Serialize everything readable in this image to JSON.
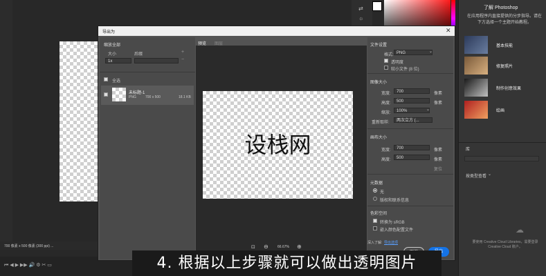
{
  "background_canvas": {},
  "status_bar": {
    "text": "700 像素 x 500 像素 (300 ppi) ..."
  },
  "dialog": {
    "title": "导出为",
    "left_panel": {
      "scale_all_label": "缩放全部",
      "size_header": "大小",
      "suffix_header": "后缀",
      "scale_value": "1x",
      "select_all_label": "全选",
      "item": {
        "name": "未标题-1",
        "format": "PNG",
        "dimensions": "700 x 500",
        "size": "18.1 KB"
      }
    },
    "preview_tabs": [
      "预览",
      "图层"
    ],
    "preview_text": "设栈网",
    "zoom": "66.67%",
    "settings": {
      "file_settings_header": "文件设置",
      "format_label": "格式:",
      "format_value": "PNG",
      "transparency_label": "透明度",
      "smaller_file_label": "较小文件 (8 位)",
      "image_size_header": "图像大小",
      "width_label": "宽度:",
      "width_value": "700",
      "height_label": "高度:",
      "height_value": "500",
      "scale_label": "缩放:",
      "scale_value": "100%",
      "resample_label": "重新取样:",
      "resample_value": "两次立方 (...",
      "unit": "像素",
      "canvas_size_header": "画布大小",
      "canvas_width_value": "700",
      "canvas_height_value": "500",
      "reset_label": "复位",
      "metadata_header": "元数据",
      "metadata_none": "无",
      "metadata_copyright": "版权和联系信息",
      "color_space_header": "色彩空间",
      "convert_srgb": "转换为 sRGB",
      "embed_profile": "嵌入颜色配置文件",
      "learn_more_prefix": "深入了解:",
      "learn_more_link": "导出选项",
      "cancel_label": "取消",
      "export_label": "导出"
    }
  },
  "right_panel": {
    "learn_title": "了解 Photoshop",
    "learn_desc": "在应用程序内直接提供的分步指导。请在下方选择一个主题开始教程。",
    "tutorials": [
      {
        "label": "基本技能"
      },
      {
        "label": "修复照片"
      },
      {
        "label": "制作创意效果"
      },
      {
        "label": "绘画"
      }
    ],
    "library_tab": "库",
    "library_note": "要使用 Creative Cloud Libraries，需要登录 Creative Cloud 账户。",
    "group_label": "按类型查看"
  },
  "subtitle": "4. 根据以上步骤就可以做出透明图片",
  "colors": {
    "export_button": "#1473e6",
    "dialog_bg": "#535353",
    "subtitle_bg": "#1a1a1a"
  }
}
